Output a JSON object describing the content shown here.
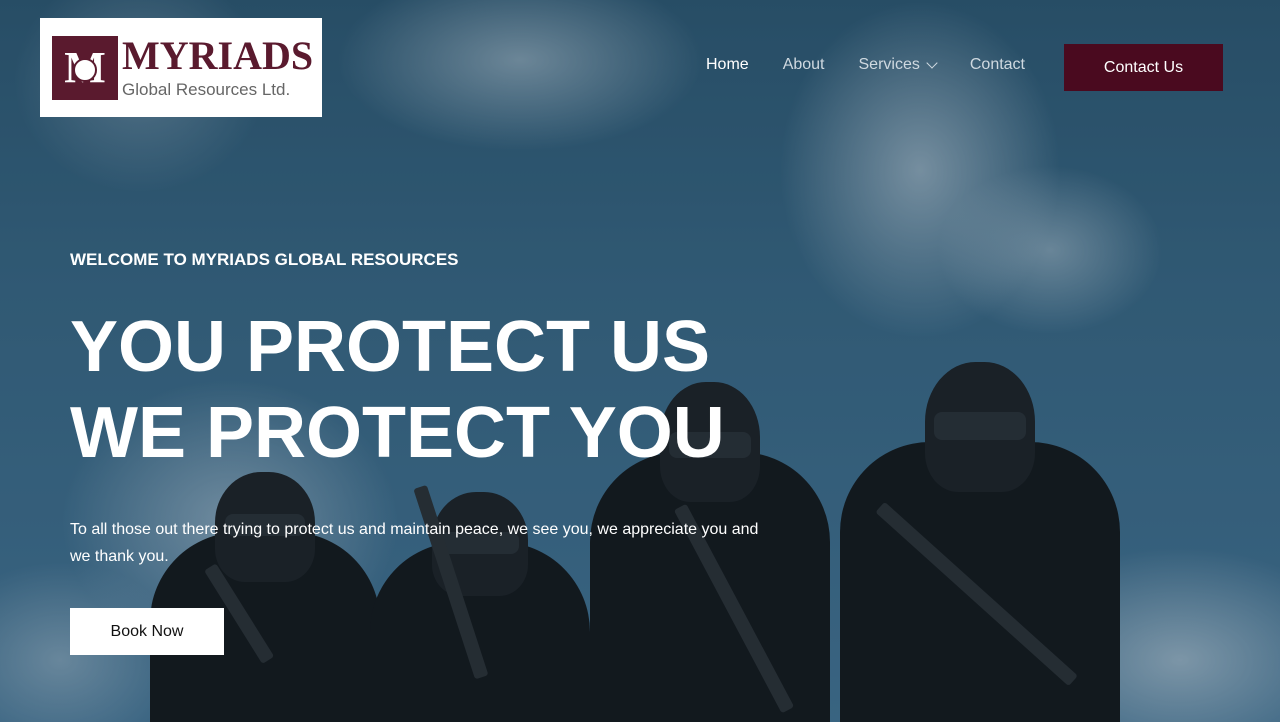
{
  "brand": {
    "name": "MYRIADS",
    "tagline": "Global Resources Ltd.",
    "primary_color": "#4a0a1f"
  },
  "nav": {
    "items": [
      {
        "label": "Home",
        "active": true
      },
      {
        "label": "About",
        "active": false
      },
      {
        "label": "Services",
        "active": false,
        "has_dropdown": true
      },
      {
        "label": "Contact",
        "active": false
      }
    ],
    "cta_label": "Contact Us"
  },
  "hero": {
    "eyebrow": "WELCOME TO MYRIADS GLOBAL RESOURCES",
    "headline": "YOU PROTECT US WE PROTECT YOU",
    "description": "To all those out there trying to protect us and maintain peace, we see you, we appreciate you and we thank you.",
    "button_label": "Book Now",
    "background_image": "soldiers-under-heart-shaped-cloud"
  }
}
